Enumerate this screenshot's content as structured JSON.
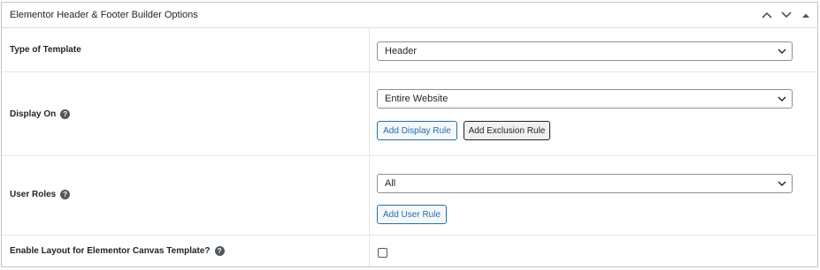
{
  "metabox": {
    "title": "Elementor Header & Footer Builder Options",
    "controls": {
      "move_up": "chevron-up-icon",
      "move_down": "chevron-down-icon",
      "toggle": "triangle-up-icon"
    }
  },
  "rows": {
    "type_of_template": {
      "label": "Type of Template",
      "select_value": "Header"
    },
    "display_on": {
      "label": "Display On",
      "select_value": "Entire Website",
      "add_display_rule": "Add Display Rule",
      "add_exclusion_rule": "Add Exclusion Rule"
    },
    "user_roles": {
      "label": "User Roles",
      "select_value": "All",
      "add_user_rule": "Add User Rule"
    },
    "canvas_template": {
      "label": "Enable Layout for Elementor Canvas Template?",
      "checked": false
    }
  },
  "icons": {
    "help": "help-icon",
    "help_glyph": "?",
    "select_arrow": "chevron-down-icon"
  },
  "colors": {
    "accent": "#2271b1",
    "text": "#1d2327",
    "border": "#8c8f94"
  }
}
